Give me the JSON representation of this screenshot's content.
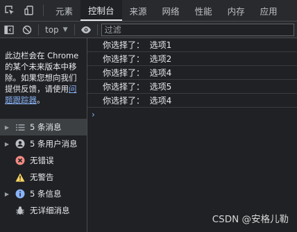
{
  "tabs": [
    {
      "label": "元素"
    },
    {
      "label": "控制台"
    },
    {
      "label": "来源"
    },
    {
      "label": "网络"
    },
    {
      "label": "性能"
    },
    {
      "label": "内存"
    },
    {
      "label": "应用"
    }
  ],
  "active_tab": "控制台",
  "toolbar": {
    "context": "top",
    "filter_placeholder": "过滤"
  },
  "sidebar": {
    "notice_text": "此边栏会在 Chrome 的某个未来版本中移除。如果您想向我们提供反馈，请使用",
    "notice_link": "问题跟踪器",
    "notice_end": "。",
    "filters": [
      {
        "label": "5 条消息",
        "icon": "list-icon",
        "expandable": true,
        "selected": true
      },
      {
        "label": "5 条用户消息",
        "icon": "user-icon",
        "expandable": true,
        "selected": false
      },
      {
        "label": "无错误",
        "icon": "error-icon",
        "expandable": false,
        "selected": false
      },
      {
        "label": "无警告",
        "icon": "warning-icon",
        "expandable": false,
        "selected": false
      },
      {
        "label": "5 条信息",
        "icon": "info-icon",
        "expandable": true,
        "selected": false
      },
      {
        "label": "无详细消息",
        "icon": "bug-icon",
        "expandable": false,
        "selected": false
      }
    ]
  },
  "console": {
    "logs": [
      "你选择了：  选项1",
      "你选择了：  选项2",
      "你选择了：  选项4",
      "你选择了：  选项5",
      "你选择了：  选项4"
    ],
    "prompt": "›"
  },
  "colors": {
    "error": "#f28b82",
    "warning": "#fdd663",
    "info": "#8ab4f8",
    "link": "#8ab4f8"
  },
  "watermark": "CSDN @安格儿勒"
}
